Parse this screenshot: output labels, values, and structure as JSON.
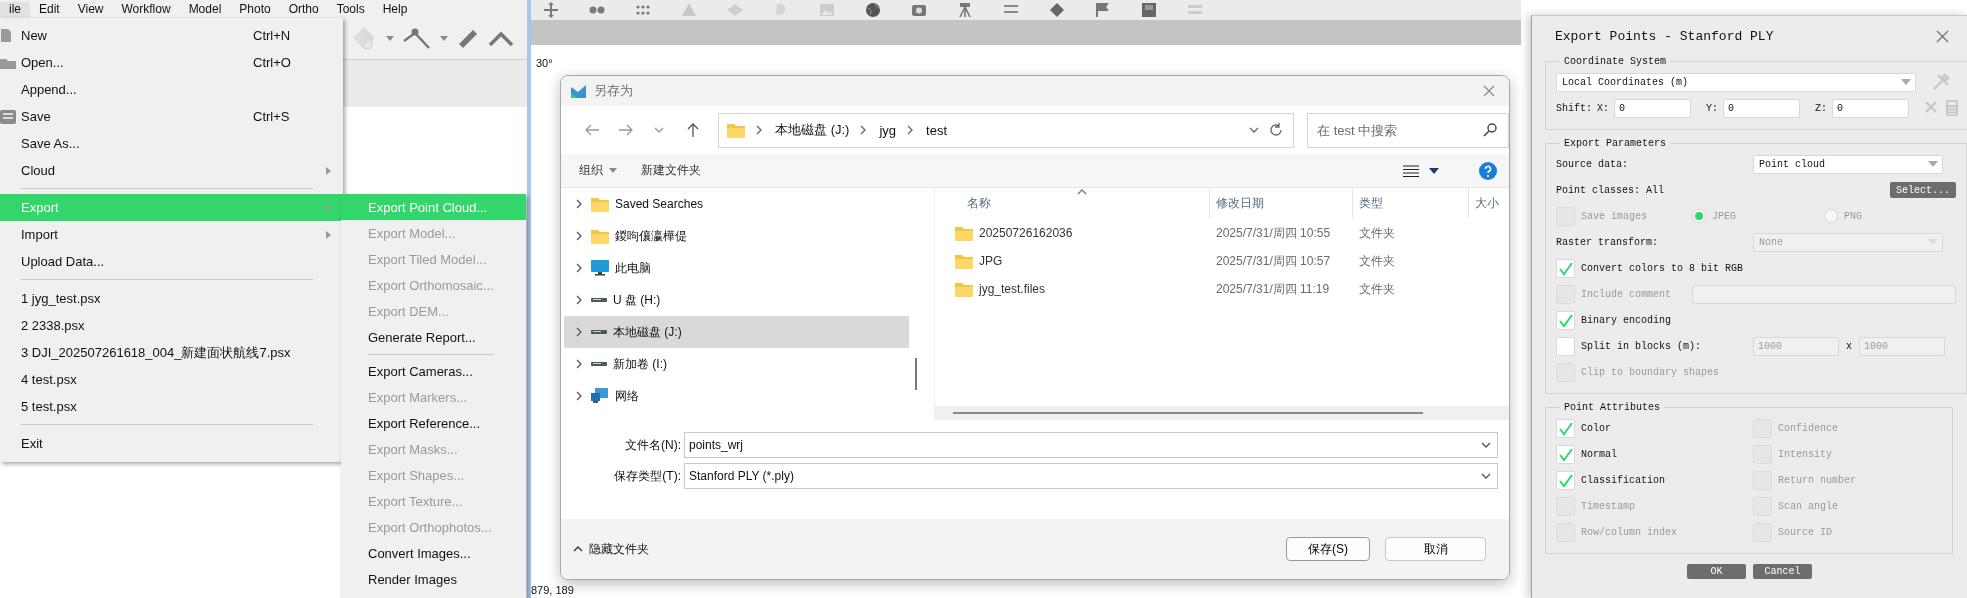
{
  "app": {
    "menu_bar": [
      {
        "label": "ile",
        "selected": true
      },
      {
        "label": "Edit",
        "selected": false
      },
      {
        "label": "View",
        "selected": false
      },
      {
        "label": "Workflow",
        "selected": false
      },
      {
        "label": "Model",
        "selected": false
      },
      {
        "label": "Photo",
        "selected": false
      },
      {
        "label": "Ortho",
        "selected": false
      },
      {
        "label": "Tools",
        "selected": false
      },
      {
        "label": "Help",
        "selected": false
      }
    ],
    "angle_label": "30°",
    "coordinates": "879, 189"
  },
  "file_menu": {
    "items": [
      {
        "kind": "icon_item",
        "label": "New",
        "shortcut": "Ctrl+N",
        "submenu": false,
        "selected": false
      },
      {
        "kind": "icon_item",
        "label": "Open...",
        "shortcut": "Ctrl+O",
        "submenu": false,
        "selected": false
      },
      {
        "kind": "item",
        "label": "Append...",
        "submenu": false,
        "selected": false
      },
      {
        "kind": "icon_item",
        "label": "Save",
        "shortcut": "Ctrl+S",
        "submenu": false,
        "selected": false
      },
      {
        "kind": "item",
        "label": "Save As...",
        "submenu": false,
        "selected": false
      },
      {
        "kind": "item",
        "label": "Cloud",
        "submenu": true,
        "selected": false
      },
      {
        "kind": "separator"
      },
      {
        "kind": "item",
        "label": "Export",
        "submenu": true,
        "selected": true
      },
      {
        "kind": "item",
        "label": "Import",
        "submenu": true,
        "selected": false
      },
      {
        "kind": "item",
        "label": "Upload Data...",
        "submenu": false,
        "selected": false
      },
      {
        "kind": "separator"
      },
      {
        "kind": "item",
        "label": "1 jyg_test.psx",
        "submenu": false,
        "selected": false
      },
      {
        "kind": "item",
        "label": "2 2338.psx",
        "submenu": false,
        "selected": false
      },
      {
        "kind": "item",
        "label": "3 DJI_202507261618_004_新建面状航线7.psx",
        "submenu": false,
        "selected": false
      },
      {
        "kind": "item",
        "label": "4 test.psx",
        "submenu": false,
        "selected": false
      },
      {
        "kind": "item",
        "label": "5 test.psx",
        "submenu": false,
        "selected": false
      },
      {
        "kind": "separator"
      },
      {
        "kind": "item",
        "label": "Exit",
        "submenu": false,
        "selected": false
      }
    ]
  },
  "export_submenu": {
    "items": [
      {
        "kind": "item",
        "label": "Export Point Cloud...",
        "disabled": false,
        "selected": true
      },
      {
        "kind": "item",
        "label": "Export Model...",
        "disabled": true,
        "selected": false
      },
      {
        "kind": "item",
        "label": "Export Tiled Model...",
        "disabled": true,
        "selected": false
      },
      {
        "kind": "item",
        "label": "Export Orthomosaic...",
        "disabled": true,
        "selected": false
      },
      {
        "kind": "item",
        "label": "Export DEM...",
        "disabled": true,
        "selected": false
      },
      {
        "kind": "item",
        "label": "Generate Report...",
        "disabled": false,
        "selected": false
      },
      {
        "kind": "separator"
      },
      {
        "kind": "item",
        "label": "Export Cameras...",
        "disabled": false,
        "selected": false
      },
      {
        "kind": "item",
        "label": "Export Markers...",
        "disabled": true,
        "selected": false
      },
      {
        "kind": "item",
        "label": "Export Reference...",
        "disabled": false,
        "selected": false
      },
      {
        "kind": "item",
        "label": "Export Masks...",
        "disabled": true,
        "selected": false
      },
      {
        "kind": "item",
        "label": "Export Shapes...",
        "disabled": true,
        "selected": false
      },
      {
        "kind": "item",
        "label": "Export Texture...",
        "disabled": true,
        "selected": false
      },
      {
        "kind": "item",
        "label": "Export Orthophotos...",
        "disabled": true,
        "selected": false
      },
      {
        "kind": "item",
        "label": "Convert Images...",
        "disabled": false,
        "selected": false
      },
      {
        "kind": "item",
        "label": "Render Images",
        "disabled": false,
        "selected": false
      }
    ]
  },
  "save_dialog": {
    "title": "另存为",
    "path": [
      "本地磁盘 (J:)",
      "jyg",
      "test"
    ],
    "search": {
      "placeholder": "在 test 中搜索"
    },
    "commands": [
      {
        "label": "组织",
        "dropdown": true
      },
      {
        "label": "新建文件夹",
        "dropdown": false
      }
    ],
    "nav_tree": [
      {
        "label": "Saved Searches",
        "kind": "folder",
        "selected": false
      },
      {
        "label": "鍐呴儴瀛樺偍",
        "kind": "folder",
        "selected": false
      },
      {
        "label": "此电脑",
        "kind": "computer",
        "selected": false
      },
      {
        "label": "U 盘 (H:)",
        "kind": "drive",
        "selected": false
      },
      {
        "label": "本地磁盘 (J:)",
        "kind": "drive",
        "selected": true
      },
      {
        "label": "新加卷 (I:)",
        "kind": "drive",
        "selected": false
      },
      {
        "label": "网络",
        "kind": "network",
        "selected": false
      }
    ],
    "columns": [
      "名称",
      "修改日期",
      "类型",
      "大小"
    ],
    "files": [
      {
        "name": "20250726162036",
        "modified": "2025/7/31/周四 10:55",
        "type": "文件夹"
      },
      {
        "name": "JPG",
        "modified": "2025/7/31/周四 10:57",
        "type": "文件夹"
      },
      {
        "name": "jyg_test.files",
        "modified": "2025/7/31/周四 11:19",
        "type": "文件夹"
      }
    ],
    "filename": {
      "label": "文件名(N):",
      "value": "points_wrj"
    },
    "filetype": {
      "label": "保存类型(T):",
      "value": "Stanford PLY (*.ply)"
    },
    "hide_folders": "隐藏文件夹",
    "buttons": [
      {
        "label": "保存(S)",
        "default": true
      },
      {
        "label": "取消",
        "default": false
      }
    ]
  },
  "export_dialog": {
    "title": "Export Points - Stanford PLY",
    "coordinate_system": {
      "title": "Coordinate System",
      "crs": "Local Coordinates (m)",
      "shift_label": "Shift:",
      "shift": [
        {
          "axis": "X:",
          "value": "0"
        },
        {
          "axis": "Y:",
          "value": "0"
        },
        {
          "axis": "Z:",
          "value": "0"
        }
      ]
    },
    "export_parameters": {
      "title": "Export Parameters",
      "rows": [
        {
          "kind": "select",
          "label": "Source data:",
          "value": "Point cloud",
          "disabled": false
        },
        {
          "kind": "button",
          "label": "Point classes: All",
          "button": "Select..."
        },
        {
          "kind": "radio",
          "label": "Save images",
          "checked": false,
          "disabled": true,
          "options": [
            {
              "label": "JPEG",
              "selected": true
            },
            {
              "label": "PNG",
              "selected": false
            }
          ]
        },
        {
          "kind": "select",
          "label": "Raster transform:",
          "value": "None",
          "disabled": true
        },
        {
          "kind": "check",
          "label": "Convert colors to 8 bit RGB",
          "checked": true,
          "disabled": false
        },
        {
          "kind": "check_field",
          "label": "Include comment",
          "checked": false,
          "disabled": true
        },
        {
          "kind": "check",
          "label": "Binary encoding",
          "checked": true,
          "disabled": false
        },
        {
          "kind": "check_pair",
          "label": "Split in blocks (m):",
          "checked": false,
          "disabled": false,
          "values": [
            "1000",
            "1000"
          ],
          "separator": "x"
        },
        {
          "kind": "check",
          "label": "Clip to boundary shapes",
          "checked": false,
          "disabled": true
        }
      ]
    },
    "point_attributes": {
      "title": "Point Attributes",
      "items": [
        {
          "label": "Color",
          "checked": true,
          "disabled": false
        },
        {
          "label": "Confidence",
          "checked": false,
          "disabled": true
        },
        {
          "label": "Normal",
          "checked": true,
          "disabled": false
        },
        {
          "label": "Intensity",
          "checked": false,
          "disabled": true
        },
        {
          "label": "Classification",
          "checked": true,
          "disabled": false
        },
        {
          "label": "Return number",
          "checked": false,
          "disabled": true
        },
        {
          "label": "Timestamp",
          "checked": false,
          "disabled": true
        },
        {
          "label": "Scan angle",
          "checked": false,
          "disabled": true
        },
        {
          "label": "Row/column index",
          "checked": false,
          "disabled": true
        },
        {
          "label": "Source ID",
          "checked": false,
          "disabled": true
        }
      ]
    },
    "buttons": [
      "OK",
      "Cancel"
    ]
  }
}
